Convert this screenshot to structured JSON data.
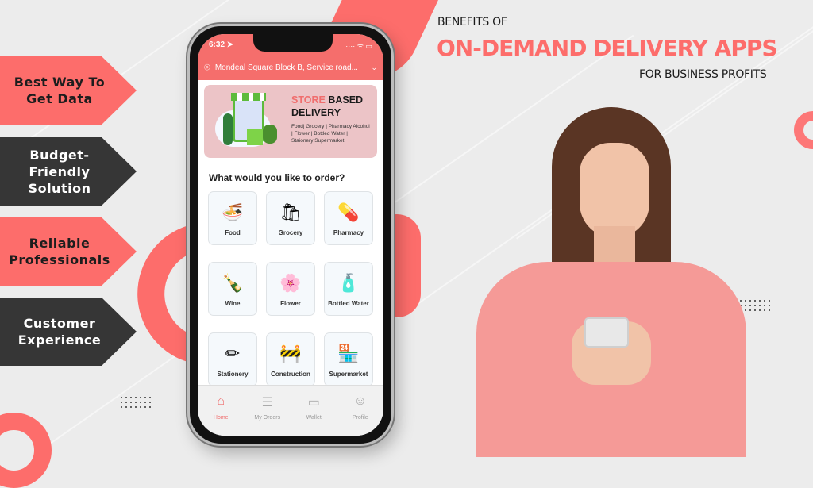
{
  "header": {
    "pre": "BENEFITS OF",
    "title": "ON-DEMAND DELIVERY APPS",
    "post": "FOR BUSINESS PROFITS"
  },
  "benefits": [
    {
      "label": "Best Way To\nGet Data",
      "style": "red"
    },
    {
      "label": "Budget-Friendly\nSolution",
      "style": "dark"
    },
    {
      "label": "Reliable\nProfessionals",
      "style": "red"
    },
    {
      "label": "Customer\nExperience",
      "style": "dark"
    }
  ],
  "colors": {
    "accent": "#fd6d6b",
    "dark": "#363636",
    "background": "#ececec"
  },
  "phone": {
    "time": "6:32 ➤",
    "status_icons": "····  ᯤ ▭",
    "location": "Mondeal Square Block B, Service road...",
    "banner": {
      "title_accent": "STORE",
      "title_rest": " BASED",
      "title_line2": "DELIVERY",
      "description": "Food| Grocery | Pharmacy Alcohol | Flower | Bottled Water | Staionery Supermarket"
    },
    "question": "What would you like to order?",
    "categories": [
      {
        "label": "Food",
        "icon": "🍜"
      },
      {
        "label": "Grocery",
        "icon": "🛍"
      },
      {
        "label": "Pharmacy",
        "icon": "💊"
      },
      {
        "label": "Wine",
        "icon": "🍾"
      },
      {
        "label": "Flower",
        "icon": "🌸"
      },
      {
        "label": "Bottled Water",
        "icon": "🧴"
      },
      {
        "label": "Stationery",
        "icon": "✏"
      },
      {
        "label": "Construction",
        "icon": "🚧"
      },
      {
        "label": "Supermarket",
        "icon": "🏪"
      }
    ],
    "tabs": [
      {
        "label": "Home",
        "icon": "⌂"
      },
      {
        "label": "My Orders",
        "icon": "☰"
      },
      {
        "label": "Wallet",
        "icon": "▭"
      },
      {
        "label": "Profile",
        "icon": "☺"
      }
    ]
  }
}
